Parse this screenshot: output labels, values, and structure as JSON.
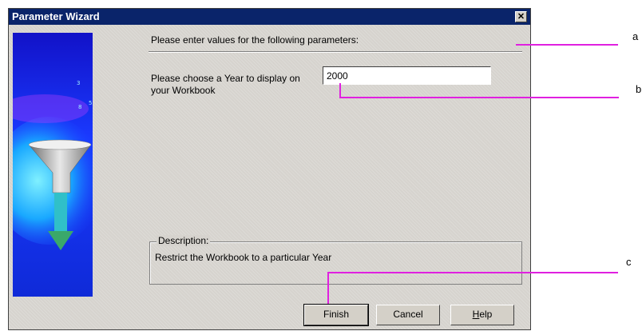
{
  "window": {
    "title": "Parameter Wizard",
    "close_glyph": "✕"
  },
  "intro": "Please enter values for the following parameters:",
  "parameter": {
    "label": "Please choose a Year to display on your Workbook",
    "value": "2000"
  },
  "description": {
    "legend": "Description:",
    "text": "Restrict the Workbook to a particular Year"
  },
  "buttons": {
    "finish": "Finish",
    "cancel": "Cancel",
    "help_first": "H",
    "help_rest": "elp"
  },
  "callouts": {
    "a": "a",
    "b": "b",
    "c": "c"
  },
  "art": {
    "icon": "funnel-arrow-icon",
    "colors": {
      "bg": "#1a3aff",
      "glow": "#19c8ff"
    }
  }
}
